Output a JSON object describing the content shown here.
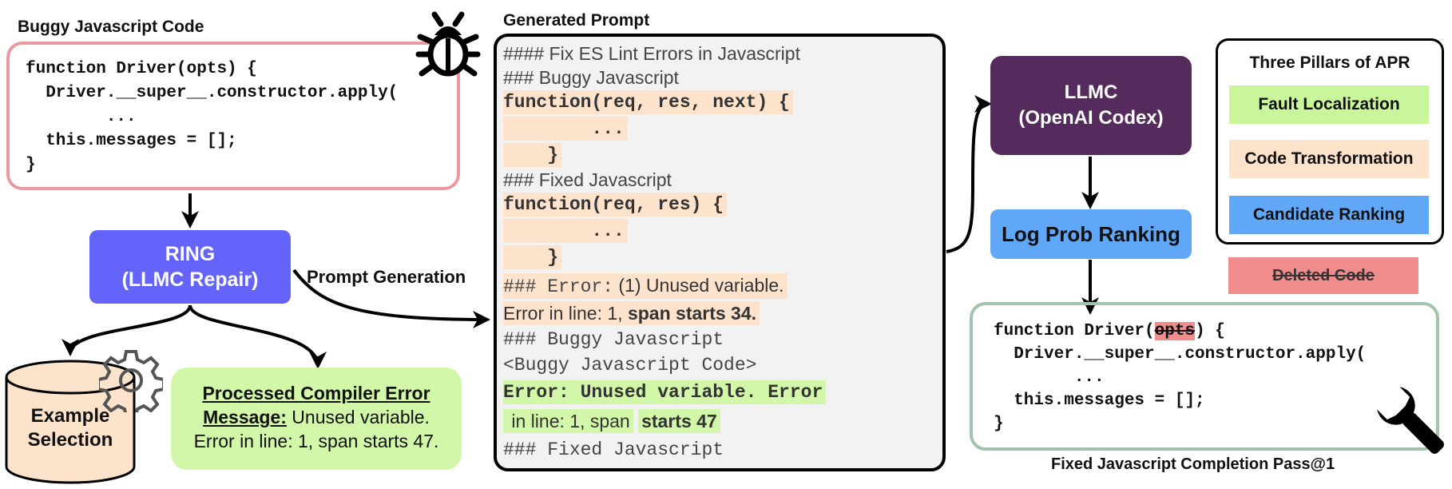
{
  "buggy": {
    "title": "Buggy Javascript Code",
    "lines": [
      "function Driver(opts) {",
      "  Driver.__super__.constructor.apply(",
      "        ...",
      "  this.messages = [];",
      "}"
    ]
  },
  "ring": {
    "line1": "RING",
    "line2": "(LLMC Repair)"
  },
  "prompt_generation_label": "Prompt Generation",
  "example": {
    "line1": "Example",
    "line2": "Selection"
  },
  "compiler": {
    "heading_line1": "Processed Compiler Error",
    "heading_line2": "Message:",
    "message_line2": " Unused variable.",
    "message_line3": "Error in line: 1, span starts 47."
  },
  "prompt": {
    "title": "Generated Prompt",
    "l1": "#### Fix ES Lint Errors in Javascript",
    "l2": "### Buggy Javascript",
    "l3": "function(req, res, next) {",
    "l4": "        ...",
    "l5": "    }",
    "l6": "### Fixed Javascript",
    "l7": "function(req, res) {",
    "l8": "        ...",
    "l9": "    }",
    "l10a": "### Error:",
    "l10b": " (1) Unused variable.",
    "l11a": "Error in line: 1,",
    "l11b": " span starts 34.",
    "l12": "### Buggy Javascript",
    "l13": "<Buggy Javascript Code>",
    "l14": "Error: Unused variable. Error",
    "l15a": " in line: 1, span",
    "l15b": "starts 47",
    "l16": "### Fixed Javascript"
  },
  "llmc": {
    "line1": "LLMC",
    "line2": "(OpenAI Codex)"
  },
  "ranking": {
    "label": "Log Prob Ranking"
  },
  "pillars": {
    "title": "Three Pillars of APR",
    "items": [
      "Fault Localization",
      "Code Transformation",
      "Candidate Ranking"
    ]
  },
  "deleted_label": "Deleted Code",
  "fixed": {
    "title": "Fixed Javascript Completion Pass@1",
    "l1a": "function Driver(",
    "l1b": "opts",
    "l1c": ") {",
    "l2": "  Driver.__super__.constructor.apply(",
    "l3": "        ...",
    "l4": "  this.messages = [];",
    "l5": "}"
  },
  "colors": {
    "ring": "#6464fa",
    "llmc": "#552a5c",
    "ranking": "#60a7f7",
    "fault": "#c9f59b",
    "transform": "#fde3cc",
    "deleted": "#f08c8c",
    "buggy_border": "#e89aa0",
    "fixed_border": "#a3c4aa"
  }
}
